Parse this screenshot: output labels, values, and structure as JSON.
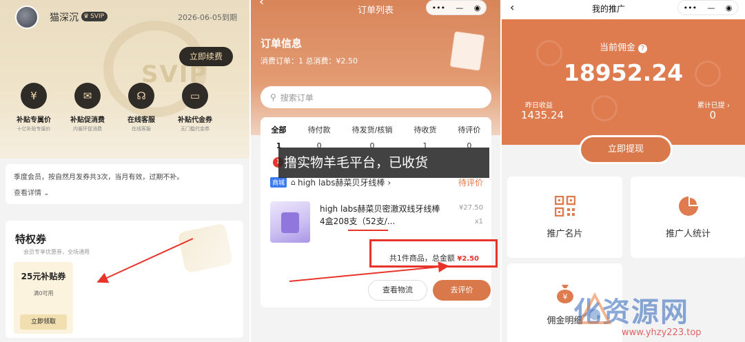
{
  "membership": {
    "username": "猫深沉",
    "vip_badge": "SVIP",
    "expire": "2026-06-05到期",
    "renew_button": "立即续费",
    "hero_watermark": "SVIP",
    "benefits": [
      {
        "title": "补贴专属价",
        "subtitle": "十亿补贴专属价",
        "icon": "tag-icon"
      },
      {
        "title": "补贴促消费",
        "subtitle": "内循环促消费",
        "icon": "gift-icon"
      },
      {
        "title": "在线客服",
        "subtitle": "在线客服",
        "icon": "headset-icon"
      },
      {
        "title": "补贴代金券",
        "subtitle": "无门槛代金券",
        "icon": "ticket-icon"
      }
    ],
    "notice_text": "季度会员，按自然月发券共3次，当月有效，过期不补。",
    "notice_more": "查看详情",
    "privilege_title": "特权券",
    "privilege_subtitle": "会员专享优惠券，全场通用",
    "coupon": {
      "amount": "25元补贴券",
      "condition": "满0可用",
      "claim_button": "立即领取"
    }
  },
  "orders": {
    "nav_title": "订单列表",
    "info_title": "订单信息",
    "info_summary": "消费订单：1 总消费：¥2.50",
    "search_placeholder": "搜索订单",
    "tabs": [
      {
        "label": "全部",
        "count": "1"
      },
      {
        "label": "待付款",
        "count": "0"
      },
      {
        "label": "待发货/核销",
        "count": "0"
      },
      {
        "label": "待收货",
        "count": "1"
      },
      {
        "label": "待评价",
        "count": "0"
      }
    ],
    "badge_count": "1",
    "banner": "撸实物羊毛平台，已收货",
    "order": {
      "mall_tag": "商城",
      "shop_name": "high labs赫菜贝牙线棒",
      "status": "待评价",
      "product_name": "high labs赫菜贝密澈双线牙线棒4盒208支（52支/...",
      "price": "¥27.50",
      "quantity": "x1",
      "summary_prefix": "共1件商品，总金额",
      "summary_amount": "¥2.50",
      "btn_logistics": "查看物流",
      "btn_review": "去评价"
    }
  },
  "promotion": {
    "nav_title": "我的推广",
    "current_label": "当前佣金",
    "current_amount": "18952.24",
    "yesterday_label": "昨日收益",
    "yesterday_value": "1435.24",
    "total_label": "累计已提",
    "total_value": "0",
    "withdraw_button": "立即提现",
    "tiles": [
      {
        "label": "推广名片",
        "icon": "qr-code-icon"
      },
      {
        "label": "推广人统计",
        "icon": "pie-chart-icon"
      },
      {
        "label": "佣金明细",
        "icon": "money-bag-icon"
      }
    ]
  },
  "watermark": {
    "text": "化资源网",
    "url": "www.yhzy223.top"
  },
  "colors": {
    "accent": "#de7b4f",
    "highlight_red": "#e8332a",
    "gold": "#f3dcb0"
  }
}
